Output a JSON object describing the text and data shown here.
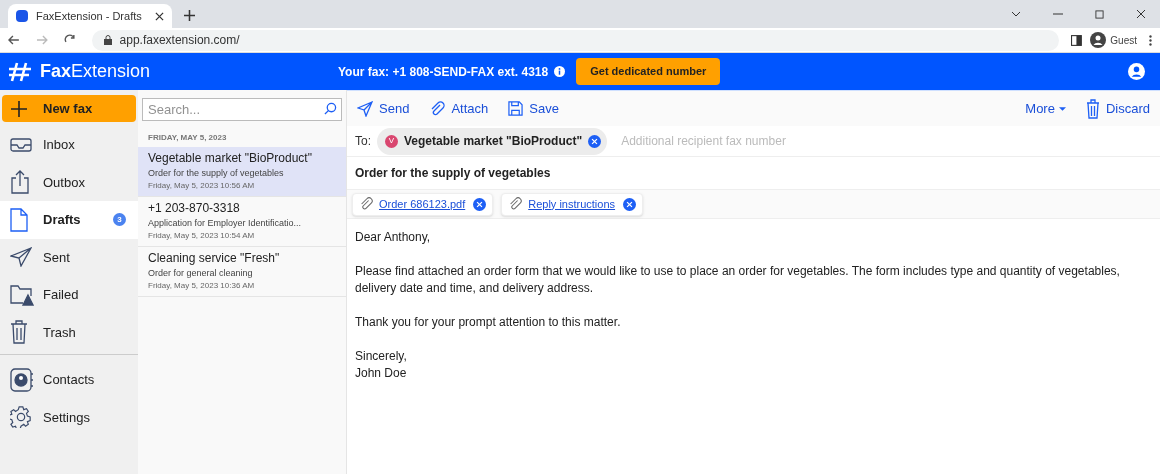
{
  "browser": {
    "tab_title": "FaxExtension - Drafts",
    "url": "app.faxextension.com/",
    "profile": "Guest"
  },
  "header": {
    "logo_bold": "Fax",
    "logo_rest": "Extension",
    "fax_label": "Your fax: +1 808-SEND-FAX ext. 4318",
    "cta": "Get dedicated number"
  },
  "new_fax": "New fax",
  "nav": [
    {
      "label": "Inbox",
      "selected": false
    },
    {
      "label": "Outbox",
      "selected": false
    },
    {
      "label": "Drafts",
      "selected": true,
      "badge": "3"
    },
    {
      "label": "Sent",
      "selected": false
    },
    {
      "label": "Failed",
      "selected": false
    },
    {
      "label": "Trash",
      "selected": false
    }
  ],
  "nav_bottom": [
    {
      "label": "Contacts",
      "selected": false
    },
    {
      "label": "Settings",
      "selected": false
    }
  ],
  "search": {
    "placeholder": "Search..."
  },
  "list": {
    "date_header": "FRIDAY, MAY 5, 2023",
    "items": [
      {
        "title": "Vegetable market \"BioProduct\"",
        "subject": "Order for the supply of vegetables",
        "time": "Friday, May 5, 2023 10:56 AM",
        "selected": true
      },
      {
        "title": "+1 203-870-3318",
        "subject": "Application for Employer Identificatio...",
        "time": "Friday, May 5, 2023 10:54 AM",
        "selected": false
      },
      {
        "title": "Cleaning service \"Fresh\"",
        "subject": "Order for general cleaning",
        "time": "Friday, May 5, 2023 10:36 AM",
        "selected": false
      }
    ]
  },
  "toolbar": {
    "send": "Send",
    "attach": "Attach",
    "save": "Save",
    "more": "More",
    "discard": "Discard"
  },
  "to": {
    "label": "To:",
    "recipient": {
      "initial": "V",
      "name": "Vegetable market \"BioProduct\"",
      "color": "#d9466f"
    },
    "placeholder": "Additional recipient fax number"
  },
  "subject": "Order for the supply of vegetables",
  "attachments": [
    "Order 686123.pdf",
    "Reply instructions"
  ],
  "body": [
    "Dear Anthony,",
    "Please find attached an order form that we would like to use to place an order for vegetables. The form includes type and quantity of vegetables, delivery date and time, and delivery address.",
    "Thank you for your prompt attention to this matter.",
    "Sincerely,\nJohn Doe"
  ]
}
